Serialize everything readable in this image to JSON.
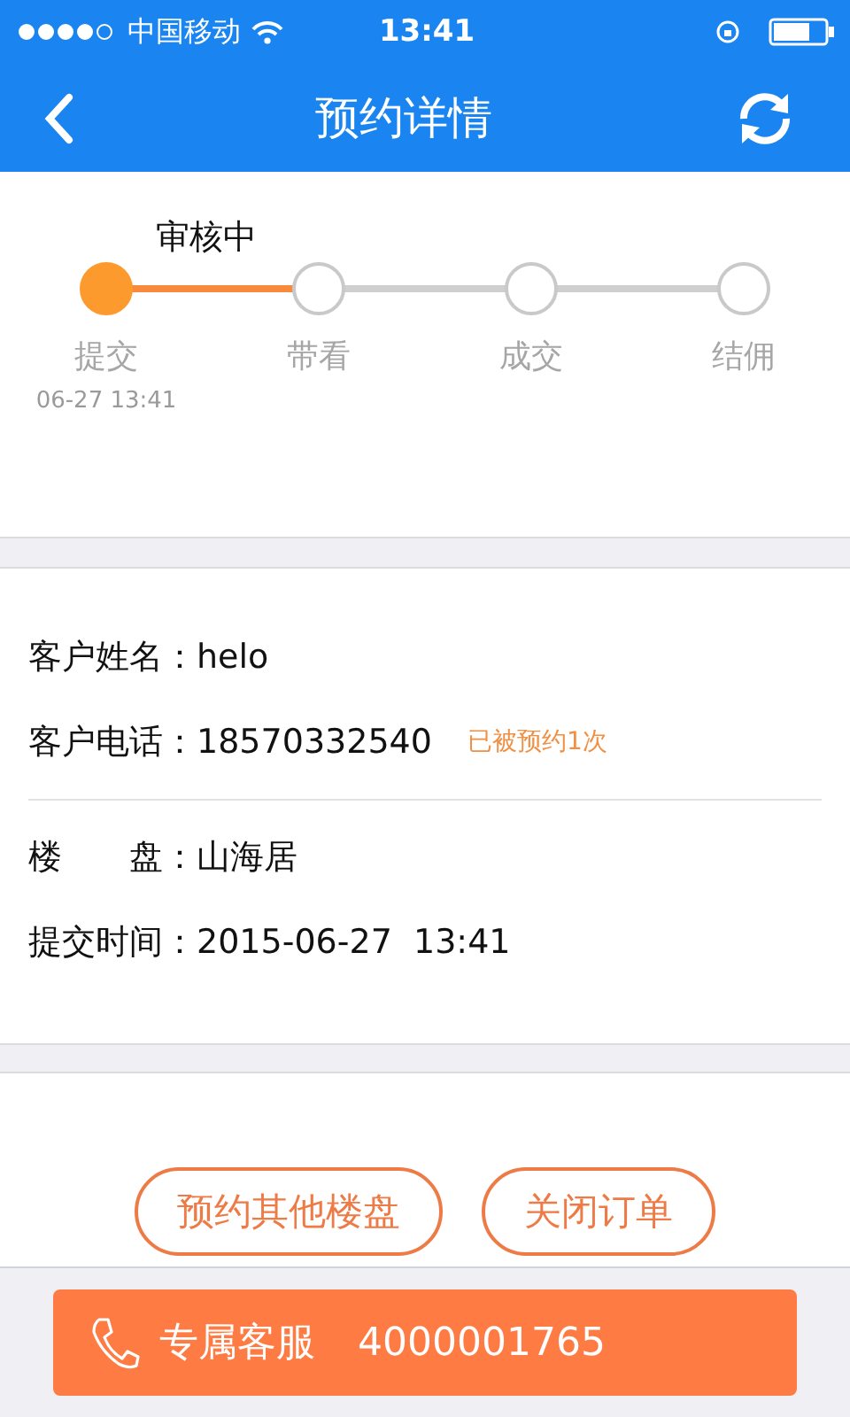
{
  "status_bar": {
    "carrier": "中国移动",
    "time": "13:41"
  },
  "nav": {
    "title": "预约详情"
  },
  "progress": {
    "status": "审核中",
    "steps": [
      {
        "label": "提交",
        "time": "06-27 13:41",
        "done": true
      },
      {
        "label": "带看",
        "done": false
      },
      {
        "label": "成交",
        "done": false
      },
      {
        "label": "结佣",
        "done": false
      }
    ]
  },
  "info": {
    "groups": [
      [
        {
          "label": "客户姓名：",
          "value": "helo"
        },
        {
          "label": "客户电话：",
          "value": "18570332540",
          "note": "已被预约1次"
        }
      ],
      [
        {
          "label": "楼　　盘：",
          "value": "山海居"
        },
        {
          "label": "提交时间：",
          "value": "2015-06-27  13:41"
        }
      ]
    ]
  },
  "actions": [
    "预约其他楼盘",
    "关闭订单"
  ],
  "service": {
    "label": "专属客服",
    "phone": "4000001765"
  }
}
